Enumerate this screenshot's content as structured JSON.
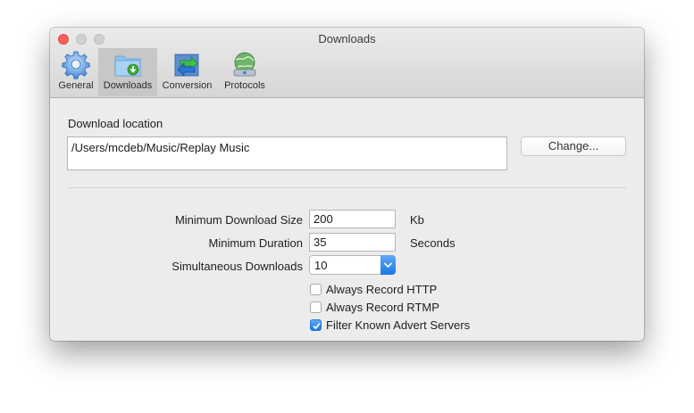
{
  "window": {
    "title": "Downloads"
  },
  "toolbar": {
    "tabs": [
      {
        "label": "General",
        "icon": "gear-icon",
        "selected": false
      },
      {
        "label": "Downloads",
        "icon": "download-folder-icon",
        "selected": true
      },
      {
        "label": "Conversion",
        "icon": "conversion-arrows-icon",
        "selected": false
      },
      {
        "label": "Protocols",
        "icon": "globe-network-icon",
        "selected": false
      }
    ]
  },
  "download_location": {
    "label": "Download location",
    "path": "/Users/mcdeb/Music/Replay Music",
    "change_button": "Change..."
  },
  "settings": {
    "min_size": {
      "label": "Minimum Download Size",
      "value": "200",
      "unit": "Kb"
    },
    "min_duration": {
      "label": "Minimum Duration",
      "value": "35",
      "unit": "Seconds"
    },
    "simultaneous": {
      "label": "Simultaneous Downloads",
      "value": "10"
    }
  },
  "options": [
    {
      "label": "Always Record HTTP",
      "checked": false
    },
    {
      "label": "Always Record RTMP",
      "checked": false
    },
    {
      "label": "Filter Known Advert Servers",
      "checked": true
    }
  ],
  "colors": {
    "close_button": "#fc605c",
    "accent_blue": "#1a76e8",
    "window_bg": "#ececec"
  }
}
